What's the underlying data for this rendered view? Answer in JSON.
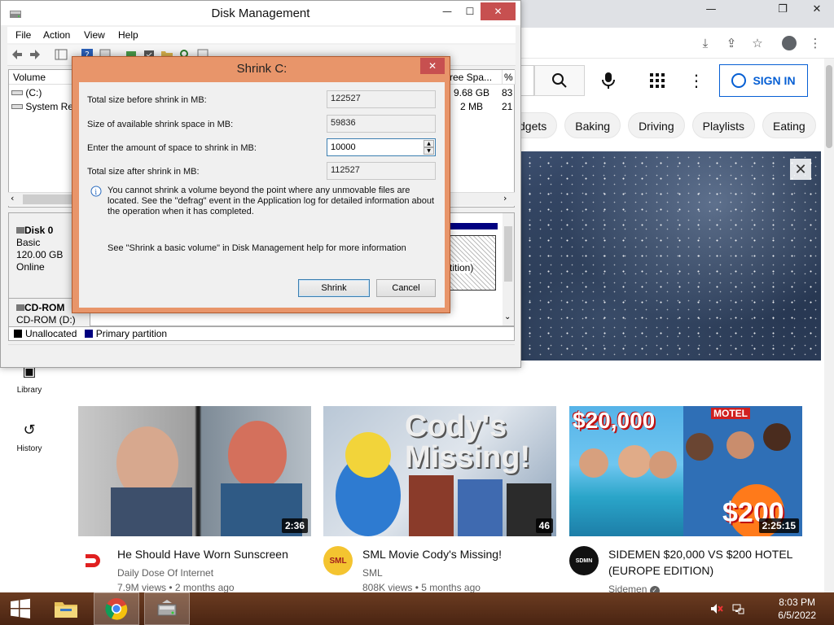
{
  "youtube": {
    "sign_in_label": "SIGN IN",
    "chips": [
      "dgets",
      "Baking",
      "Driving",
      "Playlists",
      "Eating"
    ],
    "sidebar": [
      {
        "label": "Library"
      },
      {
        "label": "History"
      }
    ],
    "videos": [
      {
        "title": "He Should Have Worn Sunscreen",
        "channel": "Daily Dose Of Internet",
        "stats": "7.9M views • 2 months ago",
        "duration": "2:36",
        "verified": false
      },
      {
        "title": "SML Movie Cody's Missing!",
        "channel": "SML",
        "stats": "808K views • 5 months ago",
        "duration": "46",
        "verified": false,
        "thumb_text": "Cody's Missing!"
      },
      {
        "title": "SIDEMEN $20,000 VS $200 HOTEL (EUROPE EDITION)",
        "channel": "Sidemen",
        "stats": "",
        "duration": "2:25:15",
        "verified": true,
        "thumb_text_1": "$20,000",
        "thumb_text_2": "$200",
        "thumb_text_3": "MOTEL"
      }
    ]
  },
  "disk_mgmt": {
    "title": "Disk Management",
    "menu": [
      "File",
      "Action",
      "View",
      "Help"
    ],
    "columns": [
      "Volume",
      "ree Spa...",
      "% F"
    ],
    "rows": [
      {
        "volume": "(C:)",
        "free": "9.68 GB",
        "pct": "83"
      },
      {
        "volume": "System Res",
        "free": "2 MB",
        "pct": "21"
      }
    ],
    "disk0": {
      "name": "Disk 0",
      "type": "Basic",
      "size": "120.00 GB",
      "status": "Online",
      "partition_label": "tition)"
    },
    "cdrom": {
      "name": "CD-ROM",
      "drive": "CD-ROM (D:)"
    },
    "legend": {
      "unallocated": "Unallocated",
      "primary": "Primary partition"
    }
  },
  "shrink_dialog": {
    "title": "Shrink C:",
    "fields": [
      {
        "label": "Total size before shrink in MB:",
        "value": "122527"
      },
      {
        "label": "Size of available shrink space in MB:",
        "value": "59836"
      },
      {
        "label": "Enter the amount of space to shrink in MB:",
        "value": "10000"
      },
      {
        "label": "Total size after shrink in MB:",
        "value": "112527"
      }
    ],
    "info": "You cannot shrink a volume beyond the point where any unmovable files are located. See the \"defrag\" event in the Application log for detailed information about the operation when it has completed.",
    "help": "See \"Shrink a basic volume\" in Disk Management help for more information",
    "shrink_label": "Shrink",
    "cancel_label": "Cancel"
  },
  "taskbar": {
    "time": "8:03 PM",
    "date": "6/5/2022"
  },
  "colors": {
    "dialog_frame": "#e8956a",
    "close_red": "#c75050",
    "primary_partition": "#000080",
    "yt_blue": "#065fd4",
    "taskbar": "#5a2e18"
  }
}
